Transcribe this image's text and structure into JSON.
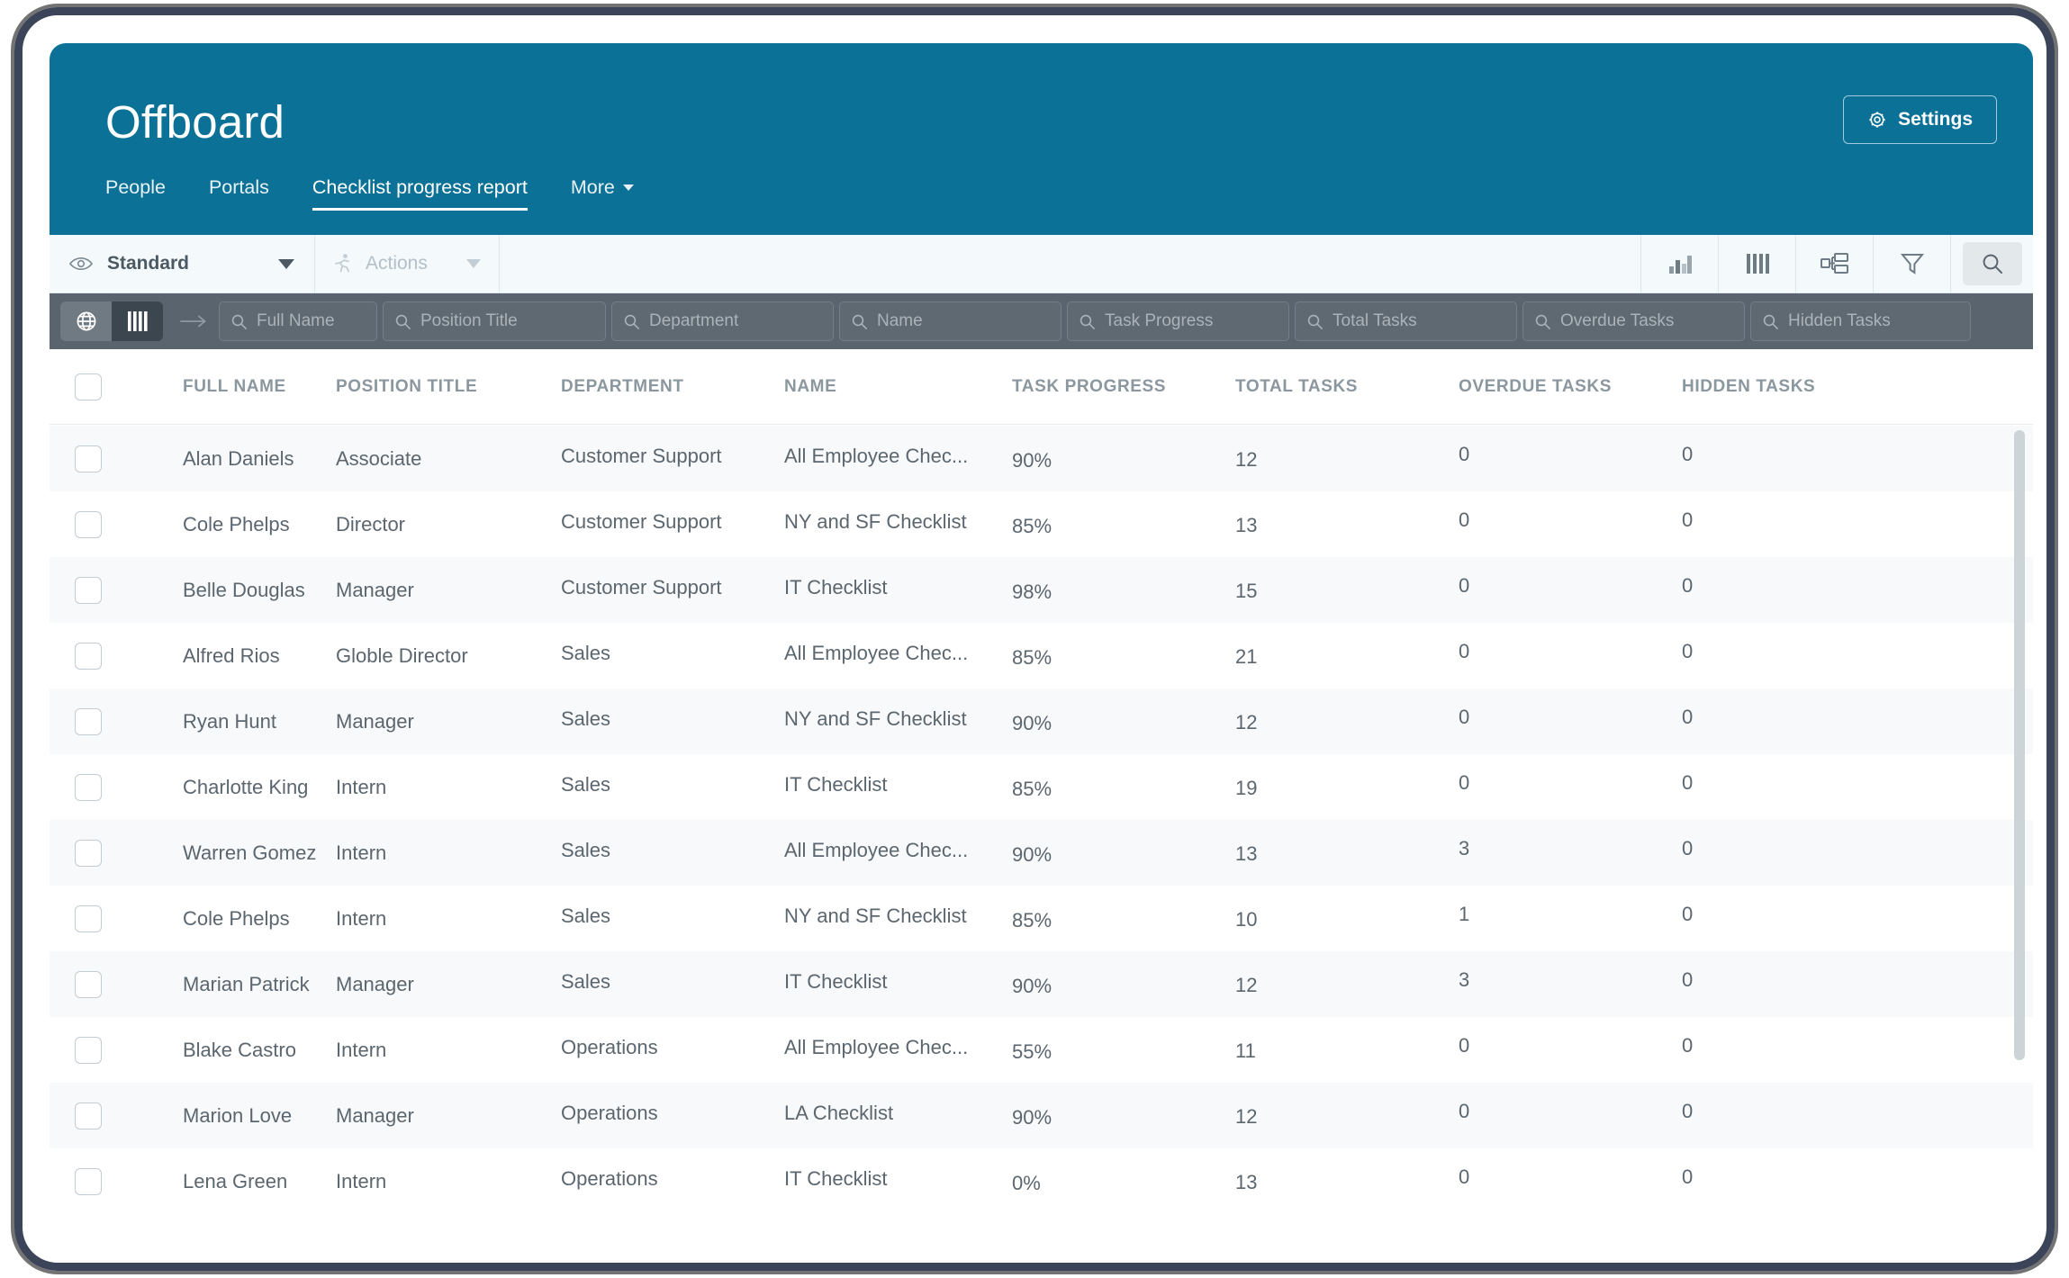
{
  "header": {
    "title": "Offboard",
    "nav": [
      {
        "label": "People",
        "active": false
      },
      {
        "label": "Portals",
        "active": false
      },
      {
        "label": "Checklist progress report",
        "active": true
      }
    ],
    "more_label": "More",
    "settings_label": "Settings",
    "bg_color": "#0c7197"
  },
  "toolbar": {
    "view_label": "Standard",
    "actions_label": "Actions",
    "icons": [
      "chart-bar-icon",
      "columns-icon",
      "group-icon",
      "filter-icon",
      "search-icon"
    ]
  },
  "filter_bar": {
    "globe_icon": "globe-icon",
    "columns_icon": "columns-icon",
    "expand_icon": "arrow-right-icon",
    "fields": [
      {
        "placeholder": "Full Name"
      },
      {
        "placeholder": "Position Title"
      },
      {
        "placeholder": "Department"
      },
      {
        "placeholder": "Name"
      },
      {
        "placeholder": "Task Progress"
      },
      {
        "placeholder": "Total Tasks"
      },
      {
        "placeholder": "Overdue Tasks"
      },
      {
        "placeholder": "Hidden Tasks"
      }
    ]
  },
  "table": {
    "columns": [
      "FULL NAME",
      "POSITION TITLE",
      "DEPARTMENT",
      "NAME",
      "TASK PROGRESS",
      "TOTAL TASKS",
      "OVERDUE TASKS",
      "HIDDEN TASKS"
    ],
    "rows": [
      {
        "full_name": "Alan Daniels",
        "position": "Associate",
        "department": "Customer Support",
        "name": "All Employee Chec...",
        "progress": "90%",
        "total": "12",
        "overdue": "0",
        "hidden": "0"
      },
      {
        "full_name": "Cole Phelps",
        "position": "Director",
        "department": "Customer Support",
        "name": "NY and SF Checklist",
        "progress": "85%",
        "total": "13",
        "overdue": "0",
        "hidden": "0"
      },
      {
        "full_name": "Belle Douglas",
        "position": "Manager",
        "department": "Customer Support",
        "name": "IT Checklist",
        "progress": "98%",
        "total": "15",
        "overdue": "0",
        "hidden": "0"
      },
      {
        "full_name": "Alfred Rios",
        "position": "Globle Director",
        "department": "Sales",
        "name": "All Employee Chec...",
        "progress": "85%",
        "total": "21",
        "overdue": "0",
        "hidden": "0"
      },
      {
        "full_name": "Ryan Hunt",
        "position": "Manager",
        "department": "Sales",
        "name": "NY and SF Checklist",
        "progress": "90%",
        "total": "12",
        "overdue": "0",
        "hidden": "0"
      },
      {
        "full_name": "Charlotte King",
        "position": "Intern",
        "department": "Sales",
        "name": "IT Checklist",
        "progress": "85%",
        "total": "19",
        "overdue": "0",
        "hidden": "0"
      },
      {
        "full_name": "Warren Gomez",
        "position": "Intern",
        "department": "Sales",
        "name": "All Employee Chec...",
        "progress": "90%",
        "total": "13",
        "overdue": "3",
        "hidden": "0"
      },
      {
        "full_name": "Cole Phelps",
        "position": "Intern",
        "department": "Sales",
        "name": "NY and SF Checklist",
        "progress": "85%",
        "total": "10",
        "overdue": "1",
        "hidden": "0"
      },
      {
        "full_name": "Marian Patrick",
        "position": "Manager",
        "department": "Sales",
        "name": "IT Checklist",
        "progress": "90%",
        "total": "12",
        "overdue": "3",
        "hidden": "0"
      },
      {
        "full_name": "Blake Castro",
        "position": "Intern",
        "department": "Operations",
        "name": "All Employee Chec...",
        "progress": "55%",
        "total": "11",
        "overdue": "0",
        "hidden": "0"
      },
      {
        "full_name": "Marion Love",
        "position": "Manager",
        "department": "Operations",
        "name": "LA Checklist",
        "progress": "90%",
        "total": "12",
        "overdue": "0",
        "hidden": "0"
      },
      {
        "full_name": "Lena Green",
        "position": "Intern",
        "department": "Operations",
        "name": "IT Checklist",
        "progress": "0%",
        "total": "13",
        "overdue": "0",
        "hidden": "0"
      }
    ]
  }
}
